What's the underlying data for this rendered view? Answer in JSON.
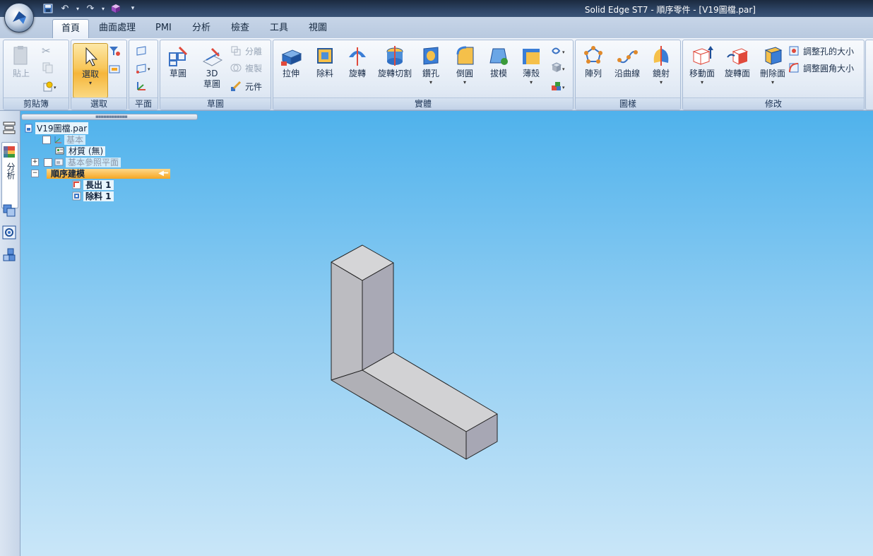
{
  "window": {
    "title": "Solid Edge ST7 - 順序零件 - [V19圖檔.par]"
  },
  "tabs": [
    {
      "label": "首頁",
      "active": true
    },
    {
      "label": "曲面處理"
    },
    {
      "label": "PMI"
    },
    {
      "label": "分析"
    },
    {
      "label": "檢查"
    },
    {
      "label": "工具"
    },
    {
      "label": "視圖"
    }
  ],
  "ribbon": {
    "clipboard": {
      "label": "剪貼簿",
      "paste": "貼上"
    },
    "select": {
      "label": "選取",
      "select_btn": "選取"
    },
    "plane": {
      "label": "平面"
    },
    "sketch": {
      "label": "草圖",
      "sketch_btn": "草圖",
      "sketch3d_line1": "3D",
      "sketch3d_line2": "草圖",
      "split": "分離",
      "copy": "複製",
      "component": "元件"
    },
    "solids": {
      "label": "實體",
      "extrude": "拉伸",
      "cutout": "除料",
      "revolve": "旋轉",
      "revolve_cut": "旋轉切割",
      "hole": "鑽孔",
      "round": "倒圓",
      "draft": "拔模",
      "thin_wall": "薄殼"
    },
    "pattern": {
      "label": "圖樣",
      "pattern_btn": "陣列",
      "along_curve": "沿曲線",
      "mirror": "鏡射"
    },
    "modify": {
      "label": "修改",
      "move_face": "移動面",
      "rotate_face": "旋轉面",
      "delete_face": "刪除面",
      "resize_hole": "調整孔的大小",
      "resize_round": "調整圓角大小"
    }
  },
  "leftbar": {
    "analysis_tab": "分析"
  },
  "tree": {
    "root": "V19圖檔.par",
    "base": "基本",
    "material": "材質 (無)",
    "ref_planes": "基本參照平面",
    "ordered": "順序建模",
    "protrusion": "長出 1",
    "cutout": "除料 1"
  },
  "colors": {
    "viewport_top": "#4fb2ec",
    "viewport_bottom": "#c9e6f8",
    "highlight": "#f5a623",
    "model_front": "#bdbdc2",
    "model_side": "#a9a9b4",
    "model_top": "#d6d6d6"
  }
}
